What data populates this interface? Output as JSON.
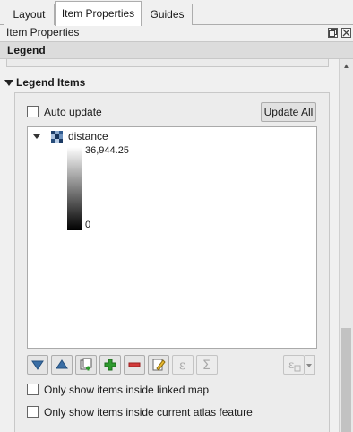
{
  "tabs": [
    {
      "label": "Layout",
      "active": false
    },
    {
      "label": "Item Properties",
      "active": true
    },
    {
      "label": "Guides",
      "active": false
    }
  ],
  "panel_title": "Item Properties",
  "section_title": "Legend",
  "legend_items": {
    "group_title": "Legend Items",
    "auto_update_label": "Auto update",
    "auto_update_checked": false,
    "update_all_label": "Update All",
    "tree": {
      "layer_name": "distance",
      "ramp_max": "36,944.25",
      "ramp_min": "0"
    },
    "toolbar_icons": [
      "move-down-icon",
      "move-up-icon",
      "add-group-icon",
      "add-item-icon",
      "remove-item-icon",
      "edit-item-icon",
      "expression-icon",
      "count-icon",
      "filter-expression-icon"
    ],
    "option_linked_map": "Only show items inside linked map",
    "option_atlas": "Only show items inside current atlas feature"
  },
  "colors": {
    "accent_blue": "#3a6ea5",
    "add_green": "#2e9a2e",
    "remove_red": "#d23a3a"
  }
}
